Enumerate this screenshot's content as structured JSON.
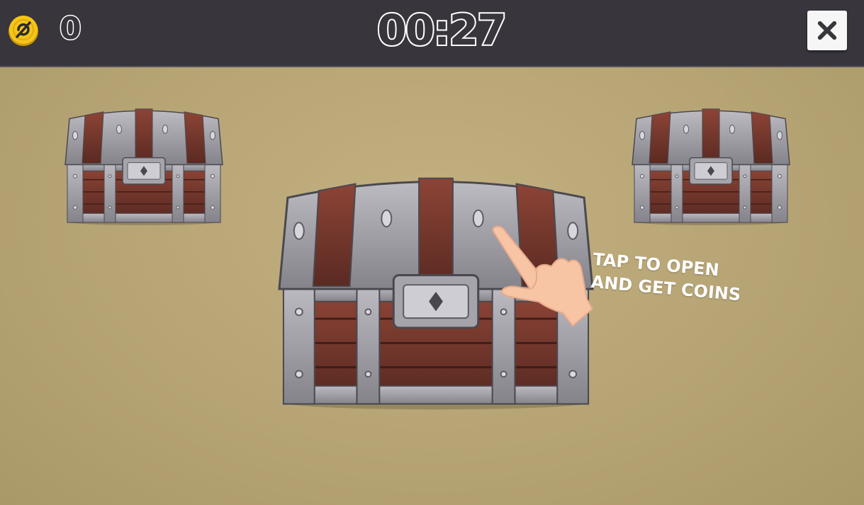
{
  "hud": {
    "coins": "0",
    "timer": "00:27",
    "coin_icon": "coin-icon",
    "close_icon": "close-icon"
  },
  "chests": [
    {
      "name": "small-chest-left",
      "size": "small"
    },
    {
      "name": "large-chest-center",
      "size": "large"
    },
    {
      "name": "small-chest-right",
      "size": "small"
    }
  ],
  "hint": {
    "line1": "TAP TO OPEN",
    "line2": "AND GET COINS"
  },
  "colors": {
    "topbar": "#38363c",
    "background": "#b9a877",
    "coin": "#f5c518",
    "wood": "#7a3a2c",
    "metal": "#9e9ca3"
  }
}
